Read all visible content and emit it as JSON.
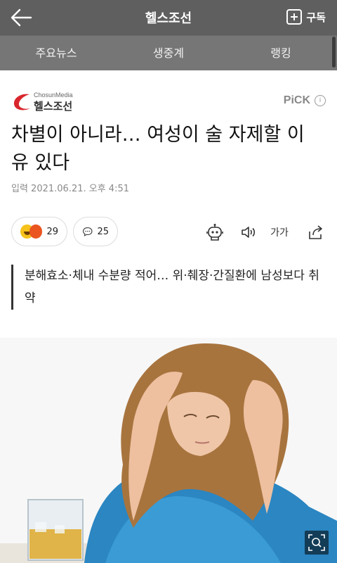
{
  "header": {
    "back_icon": "back-arrow-icon",
    "title": "헬스조선",
    "subscribe_label": "구독",
    "subscribe_icon": "plus-square-icon"
  },
  "tabs": [
    {
      "label": "주요뉴스"
    },
    {
      "label": "생중계"
    },
    {
      "label": "랭킹"
    }
  ],
  "brand": {
    "logo_en": "ChosunMedia",
    "logo_ko": "헬스조선",
    "pick_label": "PiCK",
    "info_symbol": "i"
  },
  "article": {
    "headline": "차별이 아니라… 여성이 술 자제할 이유 있다",
    "dateline": "입력 2021.06.21. 오후 4:51",
    "subhead": "분해효소·체내 수분량 적어… 위·췌장·간질환에 남성보다 취약"
  },
  "reactions": {
    "count": "29",
    "comments": "25"
  },
  "tools": {
    "font_label": "가가"
  },
  "photo": {
    "description_icon": "photo-woman-headache",
    "zoom_icon": "zoom-icon"
  },
  "colors": {
    "topbar": "#5f5f5f",
    "tabs": "#767676",
    "brand_red": "#d8262c"
  }
}
